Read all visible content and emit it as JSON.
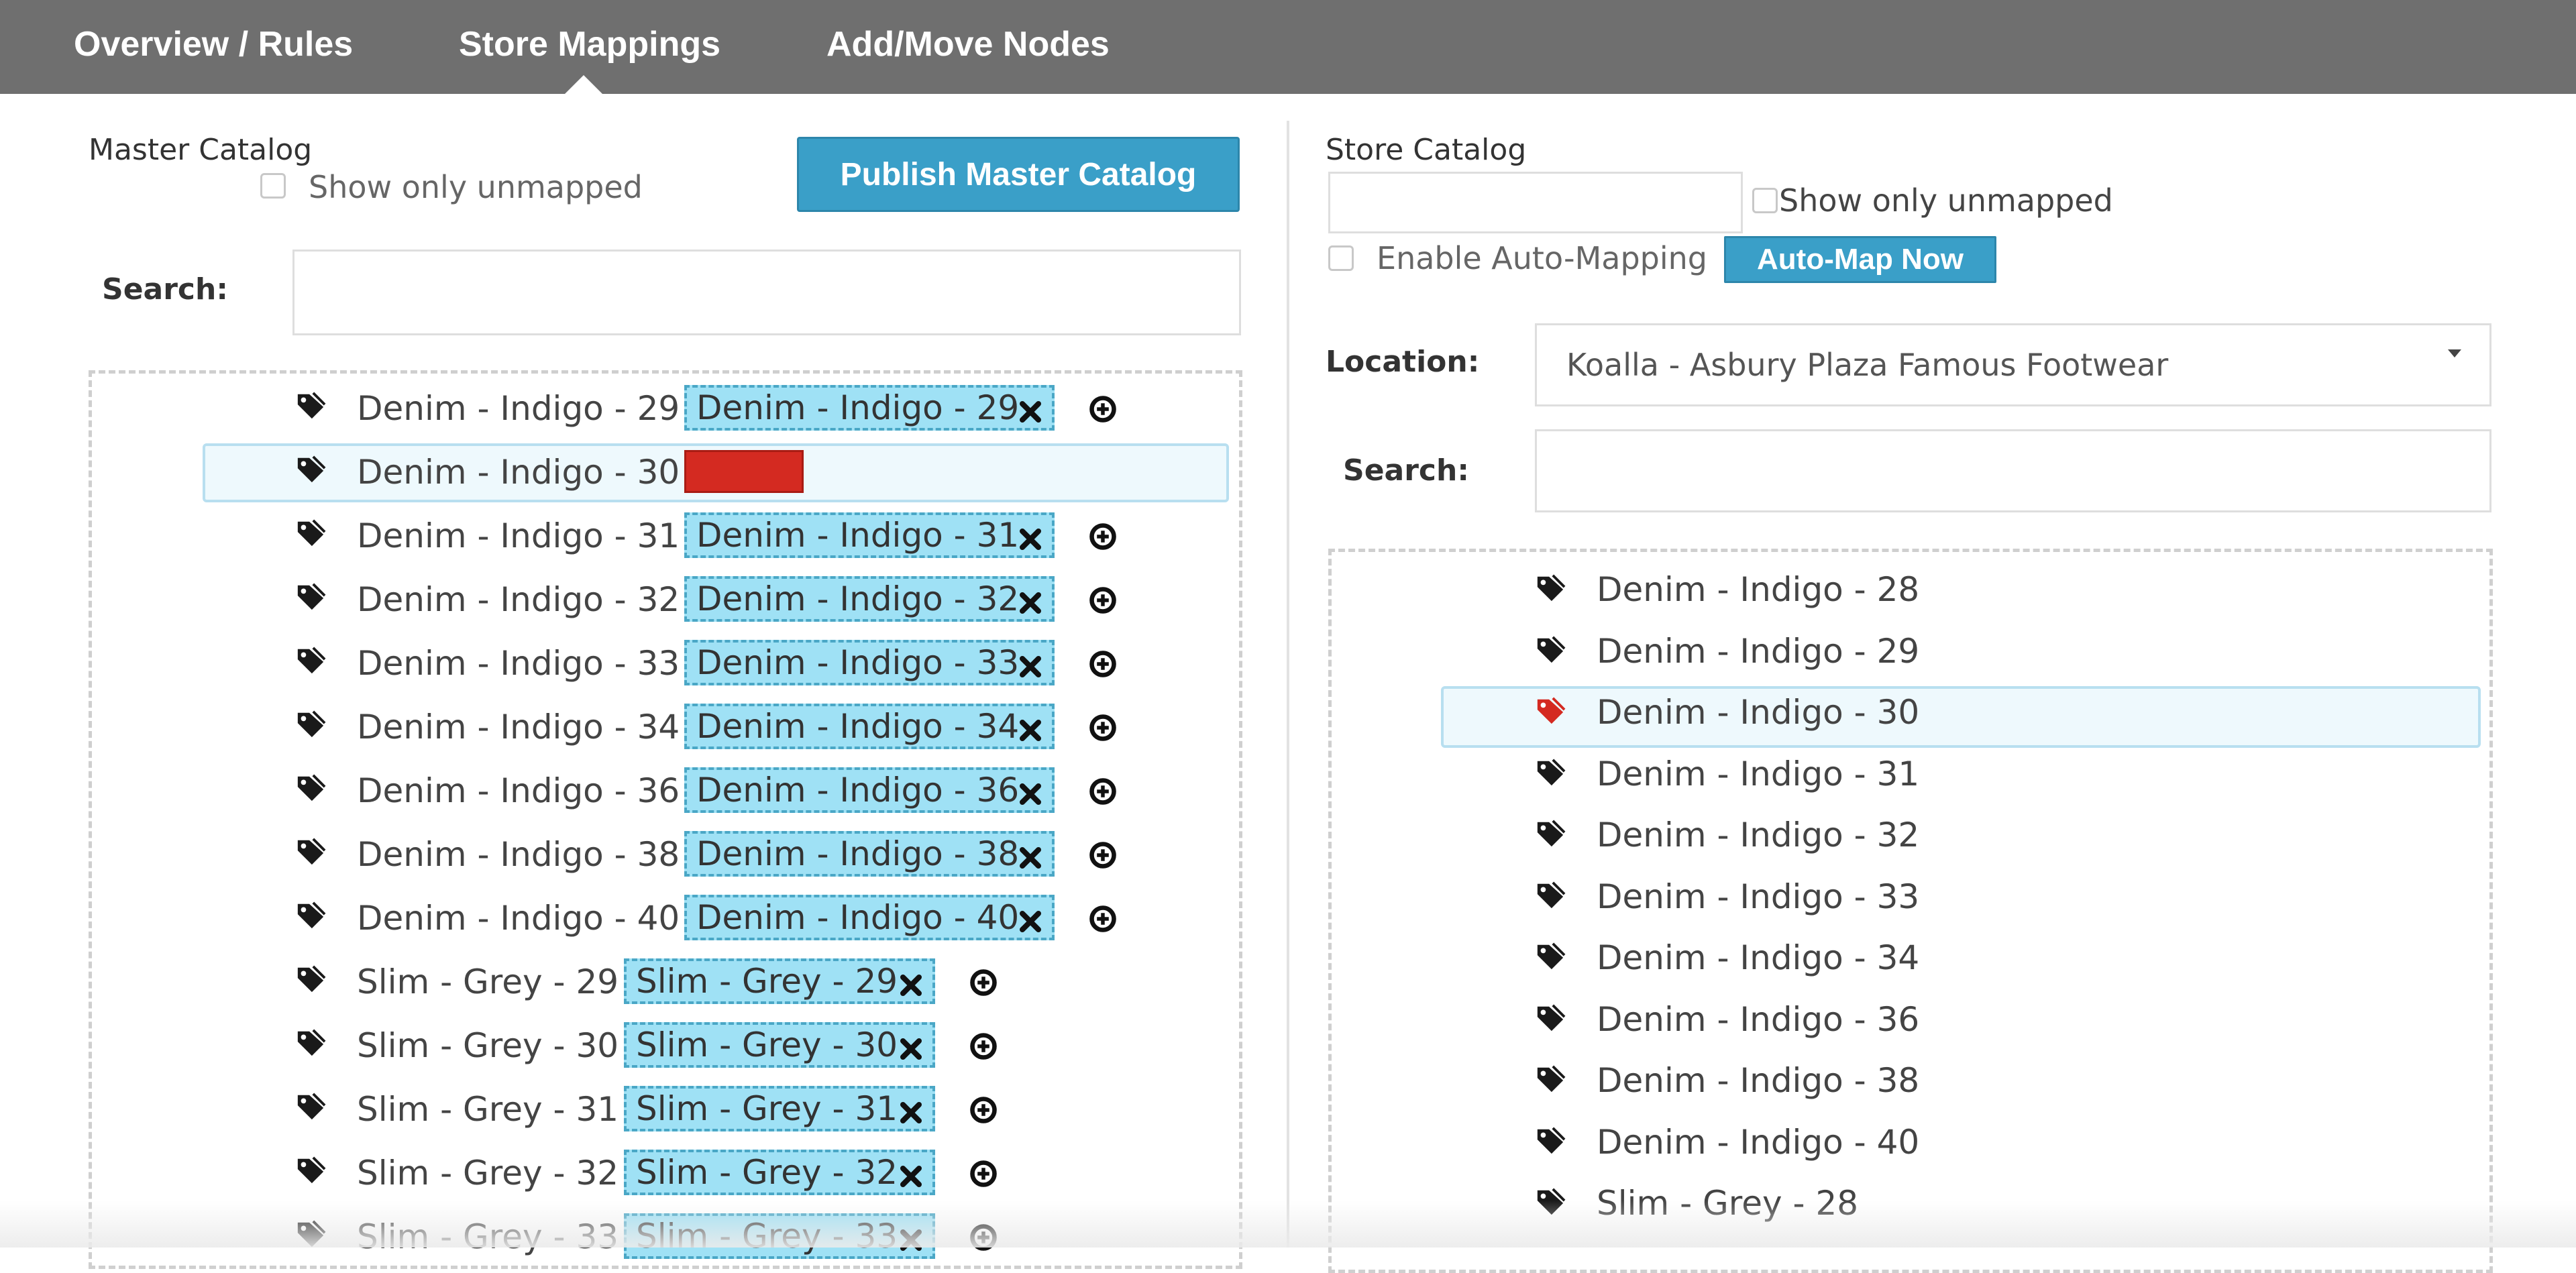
{
  "tabs": [
    {
      "label": "Overview / Rules"
    },
    {
      "label": "Store Mappings"
    },
    {
      "label": "Add/Move Nodes"
    }
  ],
  "master": {
    "title": "Master Catalog",
    "show_unmapped_label": "Show only unmapped",
    "publish_label": "Publish Master Catalog",
    "search_label": "Search:",
    "nodes": [
      {
        "label": "Denim - Indigo - 29",
        "chip": "Denim - Indigo - 29"
      },
      {
        "label": "Denim - Indigo - 30",
        "chip": ""
      },
      {
        "label": "Denim - Indigo - 31",
        "chip": "Denim - Indigo - 31"
      },
      {
        "label": "Denim - Indigo - 32",
        "chip": "Denim - Indigo - 32"
      },
      {
        "label": "Denim - Indigo - 33",
        "chip": "Denim - Indigo - 33"
      },
      {
        "label": "Denim - Indigo - 34",
        "chip": "Denim - Indigo - 34"
      },
      {
        "label": "Denim - Indigo - 36",
        "chip": "Denim - Indigo - 36"
      },
      {
        "label": "Denim - Indigo - 38",
        "chip": "Denim - Indigo - 38"
      },
      {
        "label": "Denim - Indigo - 40",
        "chip": "Denim - Indigo - 40"
      },
      {
        "label": "Slim - Grey - 29",
        "chip": "Slim - Grey - 29"
      },
      {
        "label": "Slim - Grey - 30",
        "chip": "Slim - Grey - 30"
      },
      {
        "label": "Slim - Grey - 31",
        "chip": "Slim - Grey - 31"
      },
      {
        "label": "Slim - Grey - 32",
        "chip": "Slim - Grey - 32"
      },
      {
        "label": "Slim - Grey - 33",
        "chip": "Slim - Grey - 33"
      }
    ]
  },
  "store": {
    "title": "Store Catalog",
    "show_unmapped_label": "Show only unmapped",
    "auto_mapping_label": "Enable Auto-Mapping",
    "auto_map_button": "Auto-Map Now",
    "location_label": "Location:",
    "location_value": "Koalla - Asbury Plaza Famous Footwear",
    "search_label": "Search:",
    "nodes": [
      {
        "label": "Denim - Indigo - 28"
      },
      {
        "label": "Denim - Indigo - 29"
      },
      {
        "label": "Denim - Indigo - 30"
      },
      {
        "label": "Denim - Indigo - 31"
      },
      {
        "label": "Denim - Indigo - 32"
      },
      {
        "label": "Denim - Indigo - 33"
      },
      {
        "label": "Denim - Indigo - 34"
      },
      {
        "label": "Denim - Indigo - 36"
      },
      {
        "label": "Denim - Indigo - 38"
      },
      {
        "label": "Denim - Indigo - 40"
      },
      {
        "label": "Slim - Grey - 28"
      }
    ]
  },
  "colors": {
    "topbar": "#6f6f6f",
    "accent": "#3a9fc8",
    "chip": "#9fe1f5",
    "error": "#d42a21",
    "highlight": "#eef9fd"
  }
}
